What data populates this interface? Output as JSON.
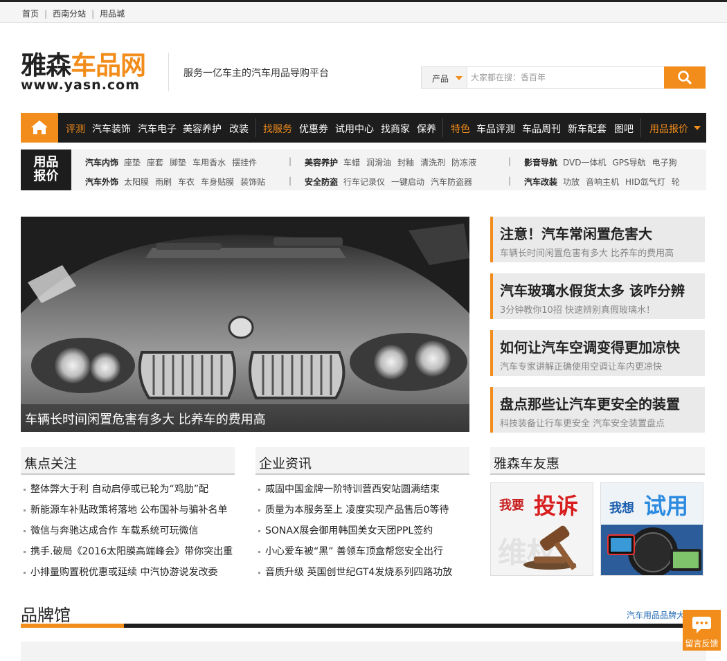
{
  "topbar": {
    "links": [
      "首页",
      "西南分站",
      "用品城"
    ]
  },
  "header": {
    "logo_cn_black": "雅森",
    "logo_cn_orange": "车品网",
    "logo_url": "www.yasn.com",
    "slogan": "服务一亿车主的汽车用品导购平台"
  },
  "search": {
    "category": "产品",
    "placeholder": "大家都在搜：香百年",
    "button_icon": "search-icon"
  },
  "nav": {
    "home_icon": "home-icon",
    "items": [
      {
        "label": "评测",
        "highlight": true
      },
      {
        "label": "汽车装饰",
        "highlight": false
      },
      {
        "label": "汽车电子",
        "highlight": false
      },
      {
        "label": "美容养护",
        "highlight": false
      },
      {
        "label": "改装",
        "highlight": false
      },
      {
        "label": "找服务",
        "highlight": true
      },
      {
        "label": "优惠券",
        "highlight": false
      },
      {
        "label": "试用中心",
        "highlight": false
      },
      {
        "label": "找商家",
        "highlight": false
      },
      {
        "label": "保养",
        "highlight": false
      },
      {
        "label": "特色",
        "highlight": true
      },
      {
        "label": "车品评测",
        "highlight": false
      },
      {
        "label": "车品周刊",
        "highlight": false
      },
      {
        "label": "新车配套",
        "highlight": false
      },
      {
        "label": "图吧",
        "highlight": false
      }
    ],
    "quote_label": "用品报价"
  },
  "subnav": {
    "tag_line1": "用品",
    "tag_line2": "报价",
    "row1": [
      {
        "title": "汽车内饰",
        "items": [
          "座垫",
          "座套",
          "脚垫",
          "车用香水",
          "摆挂件"
        ]
      },
      {
        "title": "美容养护",
        "items": [
          "车蜡",
          "润滑油",
          "封釉",
          "清洗剂",
          "防冻液"
        ]
      },
      {
        "title": "影音导航",
        "items": [
          "DVD一体机",
          "GPS导航",
          "电子狗"
        ]
      }
    ],
    "row2": [
      {
        "title": "汽车外饰",
        "items": [
          "太阳膜",
          "雨刷",
          "车衣",
          "车身贴膜",
          "装饰贴"
        ]
      },
      {
        "title": "安全防盗",
        "items": [
          "行车记录仪",
          "一键启动",
          "汽车防盗器"
        ]
      },
      {
        "title": "汽车改装",
        "items": [
          "功放",
          "音响主机",
          "HID氙气灯",
          "轮"
        ]
      }
    ],
    "separator": "|"
  },
  "hero": {
    "caption": "车辆长时间闲置危害有多大 比养车的费用高"
  },
  "side_news": [
    {
      "title": "注意！汽车常闲置危害大",
      "sub": "车辆长时间闲置危害有多大 比养车的费用高"
    },
    {
      "title": "汽车玻璃水假货太多 该咋分辨",
      "sub": "3分钟教你10招 快速辨别真假玻璃水！"
    },
    {
      "title": "如何让汽车空调变得更加凉快",
      "sub": "汽车专家讲解正确使用空调让车内更凉快"
    },
    {
      "title": "盘点那些让汽车更安全的装置",
      "sub": "科技装备让行车更安全 汽车安全装置盘点"
    }
  ],
  "focus": {
    "title": "焦点关注",
    "items": [
      "整体弊大于利 自动启停或已轮为“鸡肋”配",
      "新能源车补贴政策将落地 公布国补与骗补名单",
      "微信与奔驰达成合作 车载系统可玩微信",
      "携手.破局《2016太阳膜高端峰会》带你突出重",
      "小排量购置税优惠或延续 中汽协游说发改委"
    ]
  },
  "company": {
    "title": "企业资讯",
    "items": [
      "威固中国金牌一阶特训营西安站圆满结束",
      "质量为本服务至上 凌度实现产品售后0等待",
      "SONAX展会御用韩国美女天团PPL签约",
      "小心爱车被“黑” 善领车顶盒帮您安全出行",
      "音质升级 英国创世纪GT4发烧系列四路功放"
    ]
  },
  "deals": {
    "title": "雅森车友惠",
    "promo1": {
      "small": "我要",
      "big": "投诉",
      "bg": "维权"
    },
    "promo2": {
      "small": "我想",
      "big": "试用"
    }
  },
  "brand": {
    "title": "品牌馆",
    "link": "汽车用品品牌大"
  },
  "feedback": {
    "label": "留言反馈",
    "icon": "chat-icon"
  },
  "colors": {
    "accent": "#f28c1a",
    "dark": "#1d1d1d"
  }
}
